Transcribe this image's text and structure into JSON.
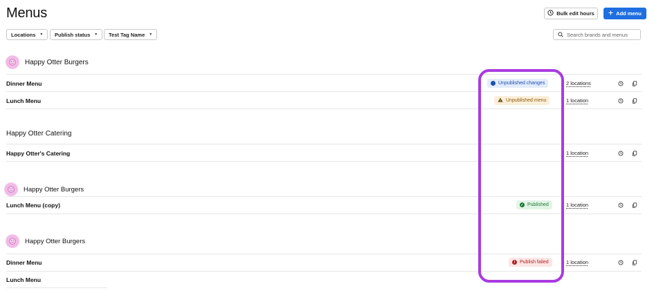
{
  "page": {
    "title": "Menus"
  },
  "header": {
    "bulk_edit_label": "Bulk edit hours",
    "add_menu_label": "Add menu"
  },
  "filters": [
    {
      "label": "Locations"
    },
    {
      "label": "Publish status"
    },
    {
      "label": "Test Tag Name"
    }
  ],
  "search": {
    "placeholder": "Search brands and menus",
    "value": ""
  },
  "groups": [
    {
      "name": "Happy Otter Burgers",
      "has_logo": true,
      "menus": [
        {
          "name": "Dinner Menu",
          "status": "Unpublished changes",
          "locations": "2 locations"
        },
        {
          "name": "Lunch Menu",
          "status": "Unpublished menu",
          "locations": "1 location"
        }
      ]
    },
    {
      "name": "Happy Otter Catering",
      "has_logo": false,
      "menus": [
        {
          "name": "Happy Otter's Catering",
          "status": "",
          "locations": "1 location"
        }
      ]
    },
    {
      "name": "Happy Otter Burgers",
      "has_logo": true,
      "menus": [
        {
          "name": "Lunch Menu (copy)",
          "status": "Published",
          "locations": "1 location"
        }
      ]
    },
    {
      "name": "Happy Otter Burgers",
      "has_logo": true,
      "menus": [
        {
          "name": "Dinner Menu",
          "status": "Publish failed",
          "locations": "1 location"
        },
        {
          "name": "Lunch Menu",
          "status": "",
          "locations": ""
        }
      ]
    }
  ],
  "colors": {
    "primary": "#1f6fe0",
    "status_unpublished_changes": "#1d4fb0",
    "status_unpublished_menu": "#8a5a10",
    "status_published": "#1c7a33",
    "status_failed": "#b02222",
    "highlight": "#a93be0"
  }
}
